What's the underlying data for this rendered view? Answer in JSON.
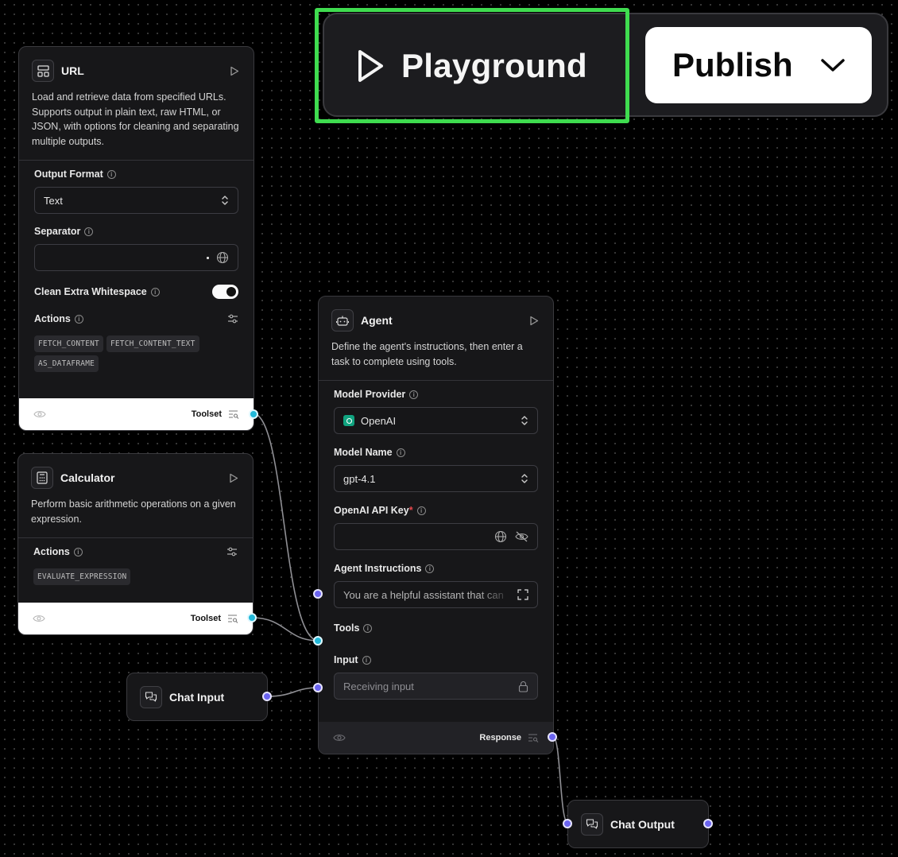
{
  "toolbar": {
    "playground_label": "Playground",
    "publish_label": "Publish",
    "highlight_color": "#3fdc4f"
  },
  "url_node": {
    "title": "URL",
    "description": "Load and retrieve data from specified URLs. Supports output in plain text, raw HTML, or JSON, with options for cleaning and separating multiple outputs.",
    "output_format_label": "Output Format",
    "output_format_value": "Text",
    "separator_label": "Separator",
    "separator_value": "",
    "clean_whitespace_label": "Clean Extra Whitespace",
    "clean_whitespace_enabled": true,
    "actions_label": "Actions",
    "actions": [
      "FETCH_CONTENT",
      "FETCH_CONTENT_TEXT",
      "AS_DATAFRAME"
    ],
    "footer_label": "Toolset"
  },
  "calculator_node": {
    "title": "Calculator",
    "description": "Perform basic arithmetic operations on a given expression.",
    "actions_label": "Actions",
    "actions": [
      "EVALUATE_EXPRESSION"
    ],
    "footer_label": "Toolset"
  },
  "agent_node": {
    "title": "Agent",
    "description": "Define the agent's instructions, then enter a task to complete using tools.",
    "model_provider_label": "Model Provider",
    "model_provider_value": "OpenAI",
    "model_name_label": "Model Name",
    "model_name_value": "gpt-4.1",
    "api_key_label": "OpenAI API Key",
    "api_key_required_mark": "*",
    "api_key_value": "",
    "instructions_label": "Agent Instructions",
    "instructions_value": "You are a helpful assistant that can",
    "tools_label": "Tools",
    "input_label": "Input",
    "input_placeholder": "Receiving input",
    "footer_label": "Response"
  },
  "chat_input_node": {
    "title": "Chat Input"
  },
  "chat_output_node": {
    "title": "Chat Output"
  },
  "colors": {
    "handle_tool": "#22b8d8",
    "handle_data": "#6b64f0",
    "required": "#e5484d"
  }
}
